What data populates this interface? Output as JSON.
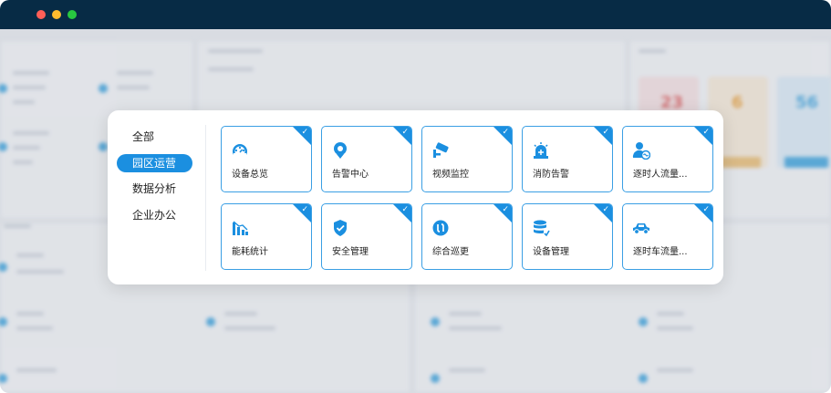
{
  "window": {
    "controls": [
      "close",
      "minimize",
      "maximize"
    ]
  },
  "menu": {
    "items": [
      {
        "label": "全部",
        "active": false
      },
      {
        "label": "园区运营",
        "active": true
      },
      {
        "label": "数据分析",
        "active": false
      },
      {
        "label": "企业办公",
        "active": false
      }
    ]
  },
  "tiles": [
    {
      "label": "设备总览",
      "icon": "gauge-icon",
      "selected": true
    },
    {
      "label": "告警中心",
      "icon": "alarm-location-icon",
      "selected": true
    },
    {
      "label": "视频监控",
      "icon": "camera-icon",
      "selected": true
    },
    {
      "label": "消防告警",
      "icon": "fire-alarm-icon",
      "selected": true
    },
    {
      "label": "逐时人流量...",
      "icon": "person-flow-icon",
      "selected": true
    },
    {
      "label": "能耗统计",
      "icon": "energy-chart-icon",
      "selected": true
    },
    {
      "label": "安全管理",
      "icon": "shield-icon",
      "selected": true
    },
    {
      "label": "综合巡更",
      "icon": "patrol-icon",
      "selected": true
    },
    {
      "label": "设备管理",
      "icon": "database-icon",
      "selected": true
    },
    {
      "label": "逐时车流量...",
      "icon": "car-icon",
      "selected": true
    }
  ],
  "colors": {
    "accent": "#1b8fe0",
    "titlebar": "#072b45",
    "tile_border": "#3a9fe4"
  }
}
